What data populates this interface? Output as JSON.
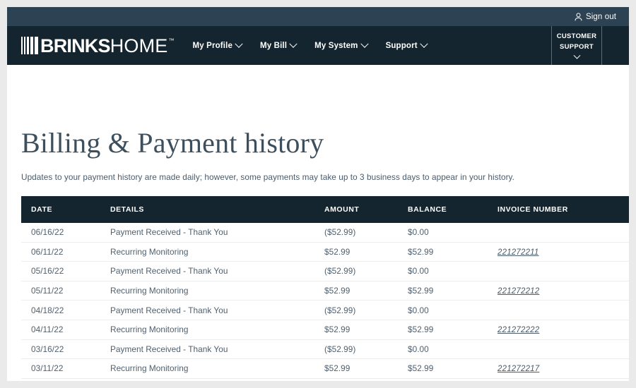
{
  "colors": {
    "utility_bar": "#2d4354",
    "nav_bar": "#14252f",
    "table_header": "#14252f",
    "page_background": "#eaeaea",
    "text_slate": "#4f5f6d",
    "link": "#4a5b6b"
  },
  "utility_bar": {
    "signout_label": "Sign out",
    "signout_icon": "user-icon"
  },
  "nav": {
    "logo": {
      "bars_icon": "barcode-bars-icon",
      "brand_bold": "BRINKS",
      "brand_light": "HOME",
      "trademark": "™"
    },
    "links": [
      {
        "label": "My Profile",
        "caret_icon": "chevron-down-icon"
      },
      {
        "label": "My Bill",
        "caret_icon": "chevron-down-icon"
      },
      {
        "label": "My System",
        "caret_icon": "chevron-down-icon"
      },
      {
        "label": "Support",
        "caret_icon": "chevron-down-icon"
      }
    ],
    "support_block": {
      "line1": "CUSTOMER",
      "line2": "SUPPORT",
      "caret_icon": "chevron-down-icon"
    }
  },
  "main": {
    "title": "Billing & Payment history",
    "subtitle": "Updates to your payment history are made daily; however, some payments may take up to 3 business days to appear in your history.",
    "table": {
      "columns": [
        "DATE",
        "DETAILS",
        "AMOUNT",
        "BALANCE",
        "INVOICE NUMBER"
      ],
      "rows": [
        {
          "date": "06/16/22",
          "details": "Payment Received - Thank You",
          "amount": "($52.99)",
          "balance": "$0.00",
          "invoice": ""
        },
        {
          "date": "06/11/22",
          "details": "Recurring Monitoring",
          "amount": "$52.99",
          "balance": "$52.99",
          "invoice": "221272211"
        },
        {
          "date": "05/16/22",
          "details": "Payment Received - Thank You",
          "amount": "($52.99)",
          "balance": "$0.00",
          "invoice": ""
        },
        {
          "date": "05/11/22",
          "details": "Recurring Monitoring",
          "amount": "$52.99",
          "balance": "$52.99",
          "invoice": "221272212"
        },
        {
          "date": "04/18/22",
          "details": "Payment Received - Thank You",
          "amount": "($52.99)",
          "balance": "$0.00",
          "invoice": ""
        },
        {
          "date": "04/11/22",
          "details": "Recurring Monitoring",
          "amount": "$52.99",
          "balance": "$52.99",
          "invoice": "221272222"
        },
        {
          "date": "03/16/22",
          "details": "Payment Received - Thank You",
          "amount": "($52.99)",
          "balance": "$0.00",
          "invoice": ""
        },
        {
          "date": "03/11/22",
          "details": "Recurring Monitoring",
          "amount": "$52.99",
          "balance": "$52.99",
          "invoice": "221272217"
        }
      ]
    }
  }
}
